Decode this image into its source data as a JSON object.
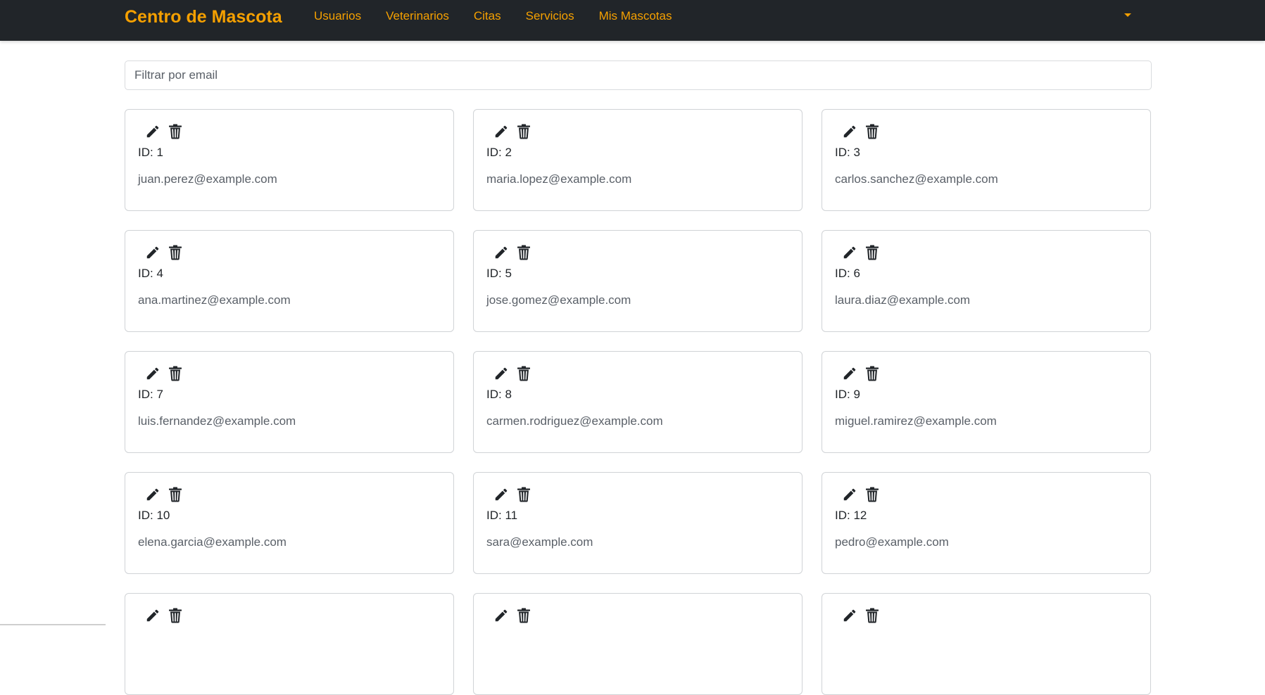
{
  "navbar": {
    "brand": "Centro de Mascota",
    "links": [
      "Usuarios",
      "Veterinarios",
      "Citas",
      "Servicios",
      "Mis Mascotas"
    ]
  },
  "filter": {
    "placeholder": "Filtrar por email",
    "value": ""
  },
  "colors": {
    "navbar_bg": "#212529",
    "accent": "#f5a000"
  },
  "icons": {
    "edit": "pencil-icon",
    "delete": "trash-icon"
  },
  "users": [
    {
      "id": "ID: 1",
      "email": "juan.perez@example.com"
    },
    {
      "id": "ID: 2",
      "email": "maria.lopez@example.com"
    },
    {
      "id": "ID: 3",
      "email": "carlos.sanchez@example.com"
    },
    {
      "id": "ID: 4",
      "email": "ana.martinez@example.com"
    },
    {
      "id": "ID: 5",
      "email": "jose.gomez@example.com"
    },
    {
      "id": "ID: 6",
      "email": "laura.diaz@example.com"
    },
    {
      "id": "ID: 7",
      "email": "luis.fernandez@example.com"
    },
    {
      "id": "ID: 8",
      "email": "carmen.rodriguez@example.com"
    },
    {
      "id": "ID: 9",
      "email": "miguel.ramirez@example.com"
    },
    {
      "id": "ID: 10",
      "email": "elena.garcia@example.com"
    },
    {
      "id": "ID: 11",
      "email": "sara@example.com"
    },
    {
      "id": "ID: 12",
      "email": "pedro@example.com"
    },
    {
      "id": "",
      "email": ""
    },
    {
      "id": "",
      "email": ""
    },
    {
      "id": "",
      "email": ""
    }
  ]
}
